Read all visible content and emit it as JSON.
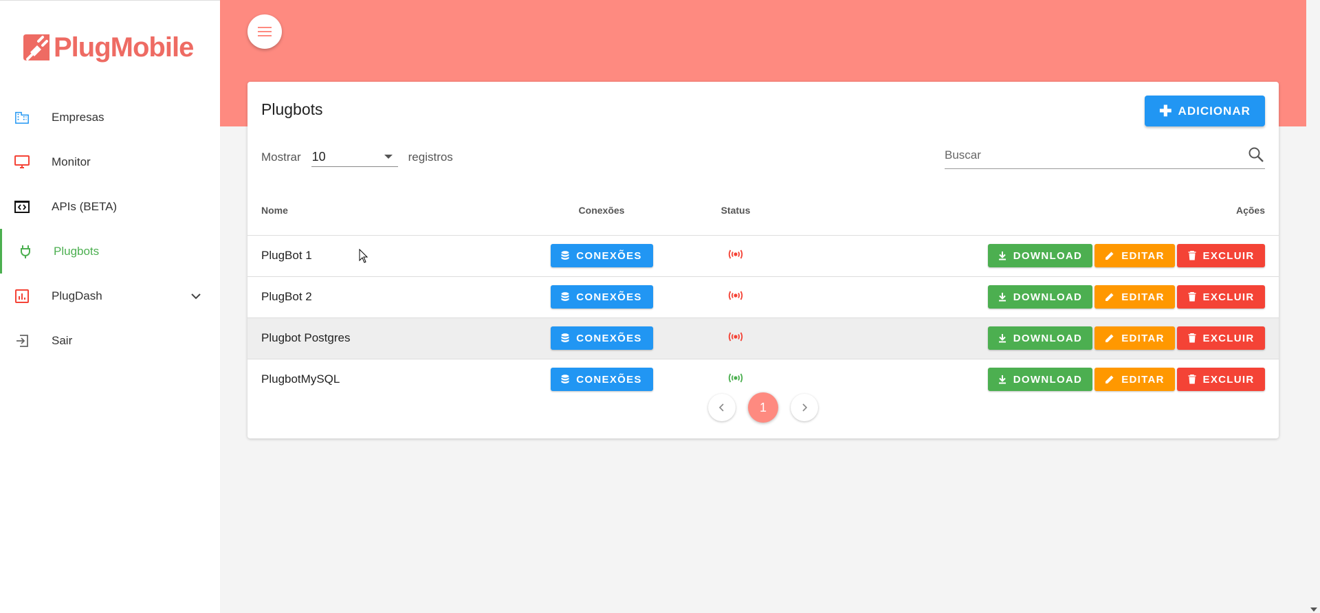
{
  "brand": {
    "name": "PlugMobile",
    "color": "#ee6b63"
  },
  "sidebar": {
    "items": [
      {
        "label": "Empresas",
        "icon": "building-icon"
      },
      {
        "label": "Monitor",
        "icon": "monitor-icon"
      },
      {
        "label": "APIs (BETA)",
        "icon": "code-icon"
      },
      {
        "label": "Plugbots",
        "icon": "plug-icon",
        "active": true
      },
      {
        "label": "PlugDash",
        "icon": "chart-icon",
        "expandable": true
      },
      {
        "label": "Sair",
        "icon": "logout-icon"
      }
    ]
  },
  "main": {
    "title": "Plugbots",
    "add_label": "ADICIONAR",
    "show_label": "Mostrar",
    "page_size": "10",
    "records_label": "registros",
    "search_placeholder": "Buscar",
    "columns": {
      "name": "Nome",
      "connections": "Conexões",
      "status": "Status",
      "actions": "Ações"
    },
    "buttons": {
      "connections": "CONEXÕES",
      "download": "DOWNLOAD",
      "edit": "EDITAR",
      "delete": "EXCLUIR"
    },
    "rows": [
      {
        "name": "PlugBot 1",
        "status": "offline"
      },
      {
        "name": "PlugBot 2",
        "status": "offline"
      },
      {
        "name": "Plugbot Postgres",
        "status": "offline"
      },
      {
        "name": "PlugbotMySQL",
        "status": "online"
      }
    ],
    "pagination": {
      "current_page": "1"
    }
  },
  "colors": {
    "header_band": "#fe8a80",
    "primary": "#2196f3",
    "success": "#4caf50",
    "warning": "#ff9800",
    "danger": "#f44336",
    "status_online": "#4caf50",
    "status_offline": "#f44336"
  }
}
